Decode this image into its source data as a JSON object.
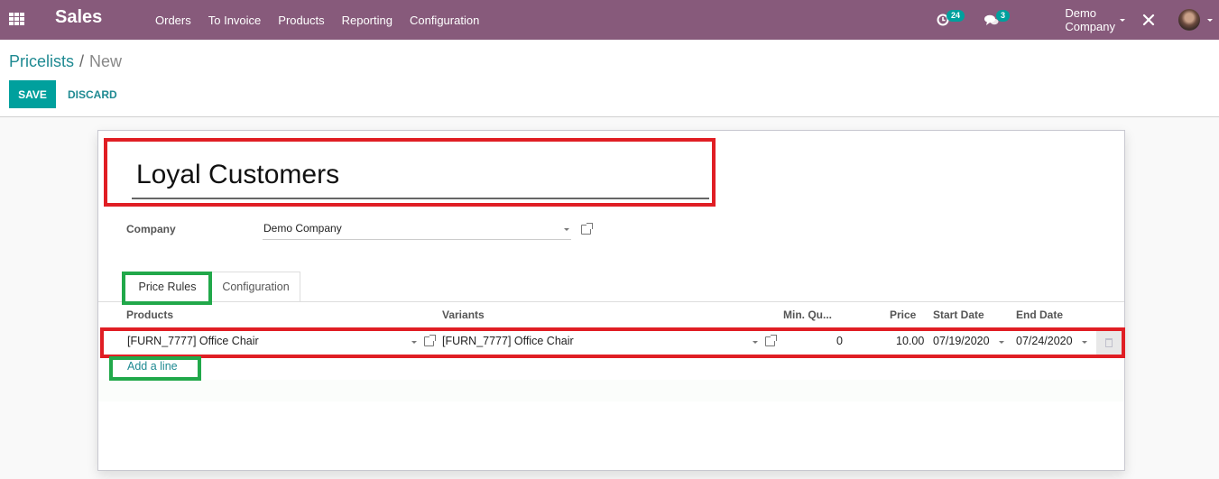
{
  "navbar": {
    "app_name": "Sales",
    "menu": [
      "Orders",
      "To Invoice",
      "Products",
      "Reporting",
      "Configuration"
    ],
    "activity_count": "24",
    "message_count": "3",
    "company": "Demo Company",
    "icons": {
      "apps": "apps-grid-icon",
      "activity": "clock-icon",
      "messages": "chat-icon",
      "debug": "tools-icon",
      "avatar": "user-avatar"
    }
  },
  "breadcrumb": {
    "parent": "Pricelists",
    "separator": "/",
    "current": "New"
  },
  "buttons": {
    "save": "SAVE",
    "discard": "DISCARD"
  },
  "form": {
    "name": "Loyal Customers",
    "company_label": "Company",
    "company_value": "Demo Company"
  },
  "tabs": [
    {
      "label": "Price Rules",
      "active": true
    },
    {
      "label": "Configuration",
      "active": false
    }
  ],
  "table": {
    "headers": {
      "products": "Products",
      "variants": "Variants",
      "min_qty": "Min. Qu...",
      "price": "Price",
      "start_date": "Start Date",
      "end_date": "End Date"
    },
    "rows": [
      {
        "product": "[FURN_7777] Office Chair",
        "variant": "[FURN_7777] Office Chair",
        "min_qty": "0",
        "price": "10.00",
        "start_date": "07/19/2020",
        "end_date": "07/24/2020"
      }
    ],
    "add_line": "Add a line"
  },
  "annotation_colors": {
    "highlight_red": "#e01e24",
    "highlight_green": "#21a84a"
  },
  "colors": {
    "navbar": "#875a7b",
    "primary": "#00a09d",
    "link": "#1f8a92"
  }
}
